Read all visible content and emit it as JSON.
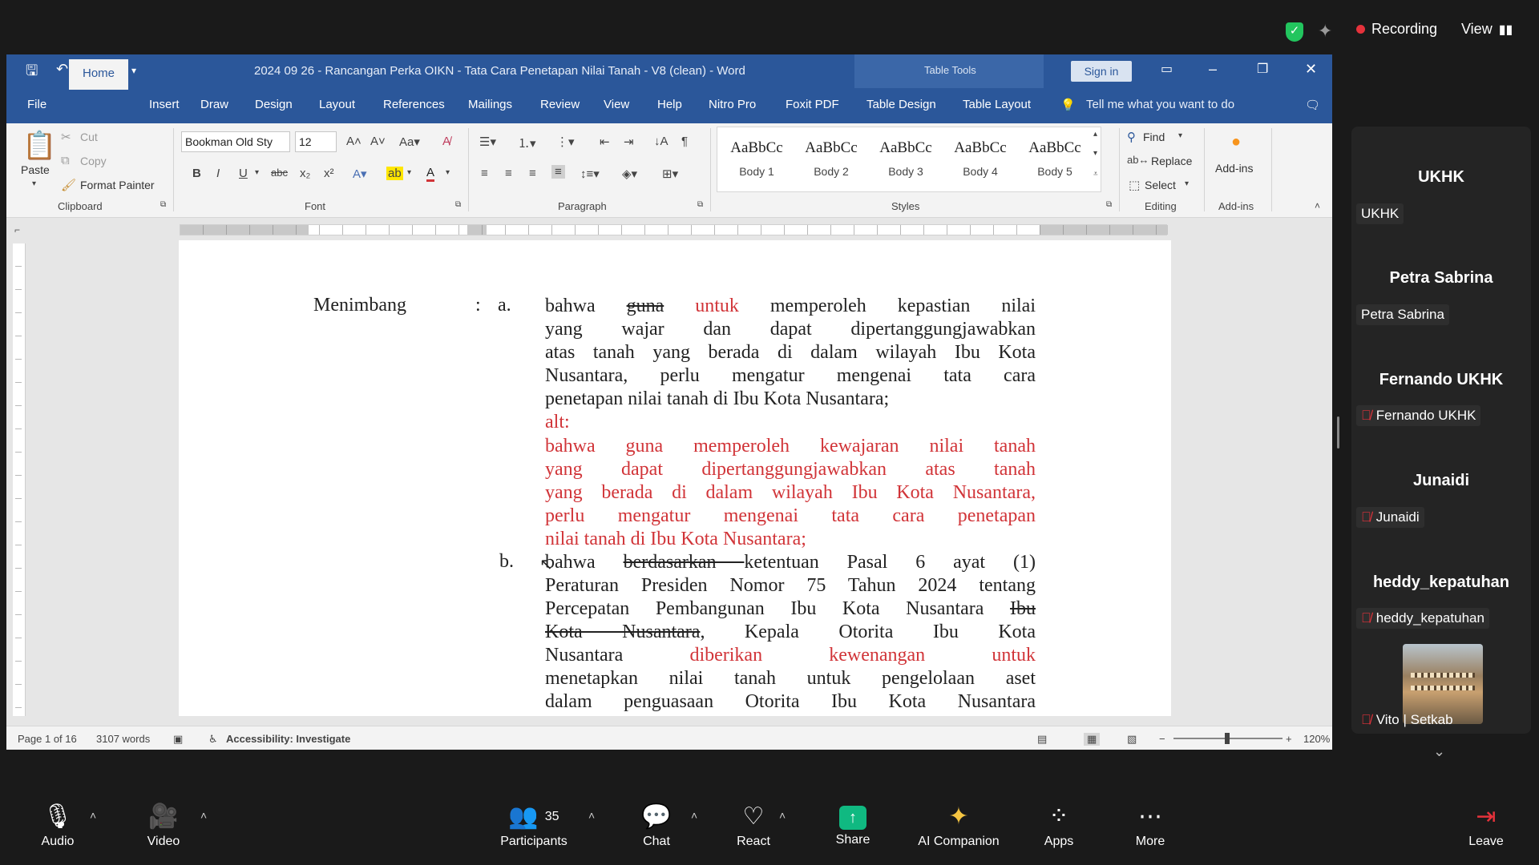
{
  "zoom_top": {
    "recording_label": "Recording",
    "view_label": "View"
  },
  "word": {
    "title": "2024 09 26 - Rancangan Perka OIKN - Tata Cara Penetapan Nilai Tanah - V8 (clean)  -  Word",
    "table_tools": "Table Tools",
    "sign_in": "Sign in",
    "menu": [
      "File",
      "Home",
      "Insert",
      "Draw",
      "Design",
      "Layout",
      "References",
      "Mailings",
      "Review",
      "View",
      "Help",
      "Nitro Pro",
      "Foxit PDF",
      "Table Design",
      "Table Layout"
    ],
    "tell_me": "Tell me what you want to do",
    "clipboard": {
      "paste": "Paste",
      "cut": "Cut",
      "copy": "Copy",
      "format_painter": "Format Painter",
      "label": "Clipboard"
    },
    "font": {
      "name": "Bookman Old Sty",
      "size": "12",
      "label": "Font"
    },
    "paragraph_label": "Paragraph",
    "styles": {
      "label": "Styles",
      "items": [
        {
          "sample": "AaBbCc",
          "name": "Body 1"
        },
        {
          "sample": "AaBbCc",
          "name": "Body 2"
        },
        {
          "sample": "AaBbCc",
          "name": "Body 3"
        },
        {
          "sample": "AaBbCc",
          "name": "Body 4"
        },
        {
          "sample": "AaBbCc",
          "name": "Body 5"
        }
      ]
    },
    "editing": {
      "find": "Find",
      "replace": "Replace",
      "select": "Select",
      "label": "Editing"
    },
    "addins": {
      "button": "Add-ins",
      "label": "Add-ins"
    },
    "status": {
      "page": "Page 1 of 16",
      "words": "3107 words",
      "accessibility": "Accessibility: Investigate",
      "zoom": "120%"
    }
  },
  "doc": {
    "menimbang": "Menimbang",
    "colon": ":",
    "item_a": "a.",
    "item_b": "b.",
    "a_line1": {
      "t1": "bahwa ",
      "strike": "guna",
      "sp": " ",
      "red": "untuk",
      "t2": " memperoleh kepastian nilai"
    },
    "a_line2": "yang wajar dan dapat dipertanggungjawabkan",
    "a_line3": "atas tanah yang berada di dalam wilayah Ibu Kota",
    "a_line4": "Nusantara, perlu mengatur mengenai tata cara",
    "a_line5": "penetapan nilai tanah di Ibu Kota Nusantara;",
    "alt": "alt:",
    "alt_line1": "bahwa guna memperoleh kewajaran nilai tanah",
    "alt_line2": "yang dapat dipertanggungjawabkan atas tanah",
    "alt_line3": "yang berada di dalam wilayah Ibu Kota Nusantara,",
    "alt_line4": "perlu mengatur mengenai tata cara penetapan",
    "alt_line5": "nilai tanah di Ibu Kota Nusantara;",
    "b_line1": {
      "t1": "bahwa ",
      "strike": "berdasarkan ",
      "t2": "ketentuan Pasal 6 ayat (1)"
    },
    "b_line2": "Peraturan Presiden Nomor 75 Tahun 2024 tentang",
    "b_line3": {
      "t1": "Percepatan Pembangunan Ibu Kota Nusantara ",
      "strike": "Ibu"
    },
    "b_line4": {
      "strike": "Kota Nusantara",
      "t1": ", Kepala Otorita Ibu Kota"
    },
    "b_line5": {
      "t1": "Nusantara ",
      "red": "diberikan kewenangan untuk"
    },
    "b_line6": "menetapkan nilai tanah untuk pengelolaan aset",
    "b_line7": "dalam penguasaan Otorita Ibu Kota Nusantara"
  },
  "participants": [
    {
      "name": "UKHK",
      "tag": "UKHK",
      "muted": false
    },
    {
      "name": "Petra Sabrina",
      "tag": "Petra Sabrina",
      "muted": false
    },
    {
      "name": "Fernando UKHK",
      "tag": "Fernando UKHK",
      "muted": true
    },
    {
      "name": "Junaidi",
      "tag": "Junaidi",
      "muted": true
    },
    {
      "name": "heddy_kepatuhan",
      "tag": "heddy_kepatuhan",
      "muted": true
    },
    {
      "name": "",
      "tag": "Vito | Setkab",
      "muted": true
    }
  ],
  "toolbar": {
    "audio": "Audio",
    "video": "Video",
    "participants": "Participants",
    "participants_count": "35",
    "chat": "Chat",
    "react": "React",
    "share": "Share",
    "ai": "AI Companion",
    "apps": "Apps",
    "more": "More",
    "leave": "Leave"
  },
  "colors": {
    "word_blue": "#2b579a",
    "track_red": "#d13438",
    "share_green": "#10b981",
    "zoom_red": "#e5323b"
  }
}
